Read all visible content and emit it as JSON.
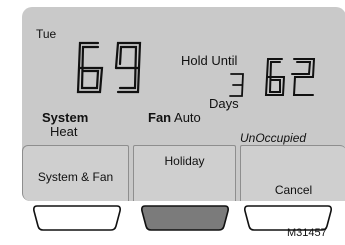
{
  "display": {
    "day": "Tue",
    "current_temp": "69",
    "hold_label": "Hold Until",
    "hold_days_value": "3",
    "days_label": "Days",
    "setpoint": "62",
    "system_label": "System",
    "system_mode": "Heat",
    "fan_label": "Fan",
    "fan_mode": "Auto",
    "occupancy_status": "UnOccupied"
  },
  "softkeys": [
    {
      "label": "System & Fan"
    },
    {
      "label": "Holiday"
    },
    {
      "label": "Cancel"
    }
  ],
  "hardware_buttons": [
    {
      "name": "left",
      "pressed": false
    },
    {
      "name": "center",
      "pressed": true
    },
    {
      "name": "right",
      "pressed": false
    }
  ],
  "figure_code": "M31457"
}
